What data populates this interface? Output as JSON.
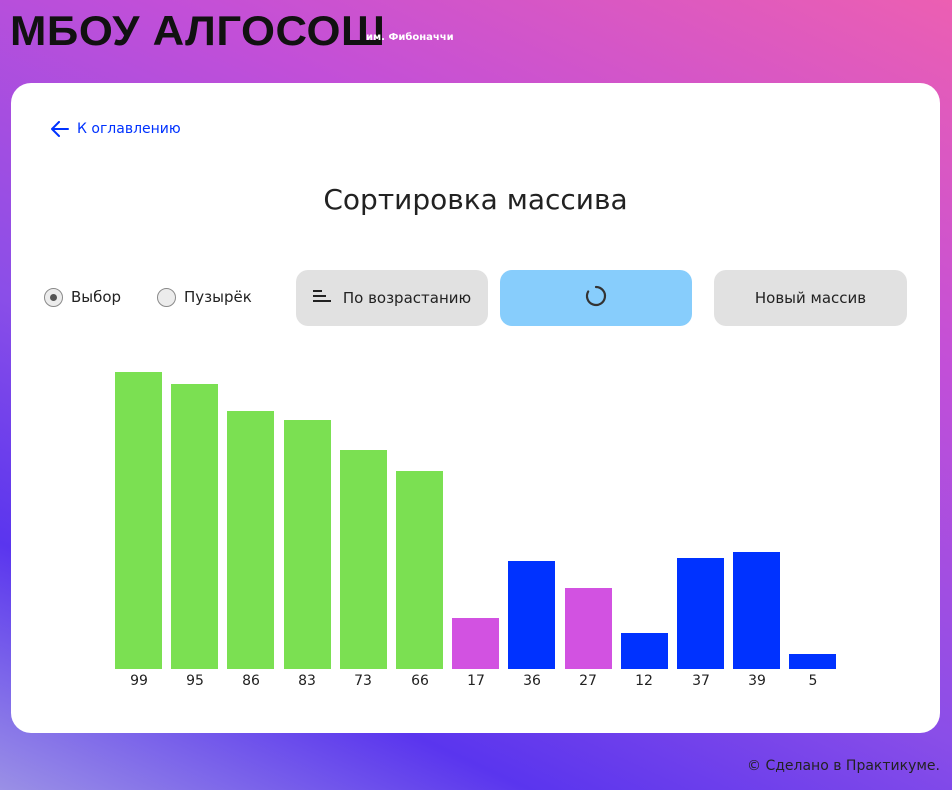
{
  "header": {
    "logo": "МБОУ АЛГОСОШ",
    "subtitle": "им. Фибоначчи"
  },
  "back_link": {
    "label": "К оглавлению",
    "icon": "arrow-left-icon"
  },
  "page_title": "Сортировка массива",
  "controls": {
    "radio_selection": "Выбор",
    "radio_bubble": "Пузырёк",
    "selected": "Выбор",
    "ascending_label": "По возрастанию",
    "ascending_icon": "sort-ascending-icon",
    "descending_state": "loading",
    "descending_icon": "spinner-icon",
    "new_array_label": "Новый массив"
  },
  "colors": {
    "sorted": "#7be052",
    "changing": "#d252e1",
    "default": "#0032ff",
    "accent": "#0032ff",
    "loading_button": "#87cdfc"
  },
  "chart_data": {
    "type": "bar",
    "categories": [
      "99",
      "95",
      "86",
      "83",
      "73",
      "66",
      "17",
      "36",
      "27",
      "12",
      "37",
      "39",
      "5"
    ],
    "values": [
      99,
      95,
      86,
      83,
      73,
      66,
      17,
      36,
      27,
      12,
      37,
      39,
      5
    ],
    "states": [
      "sorted",
      "sorted",
      "sorted",
      "sorted",
      "sorted",
      "sorted",
      "changing",
      "default",
      "changing",
      "default",
      "default",
      "default",
      "default"
    ]
  },
  "footer": "© Сделано в Практикуме."
}
